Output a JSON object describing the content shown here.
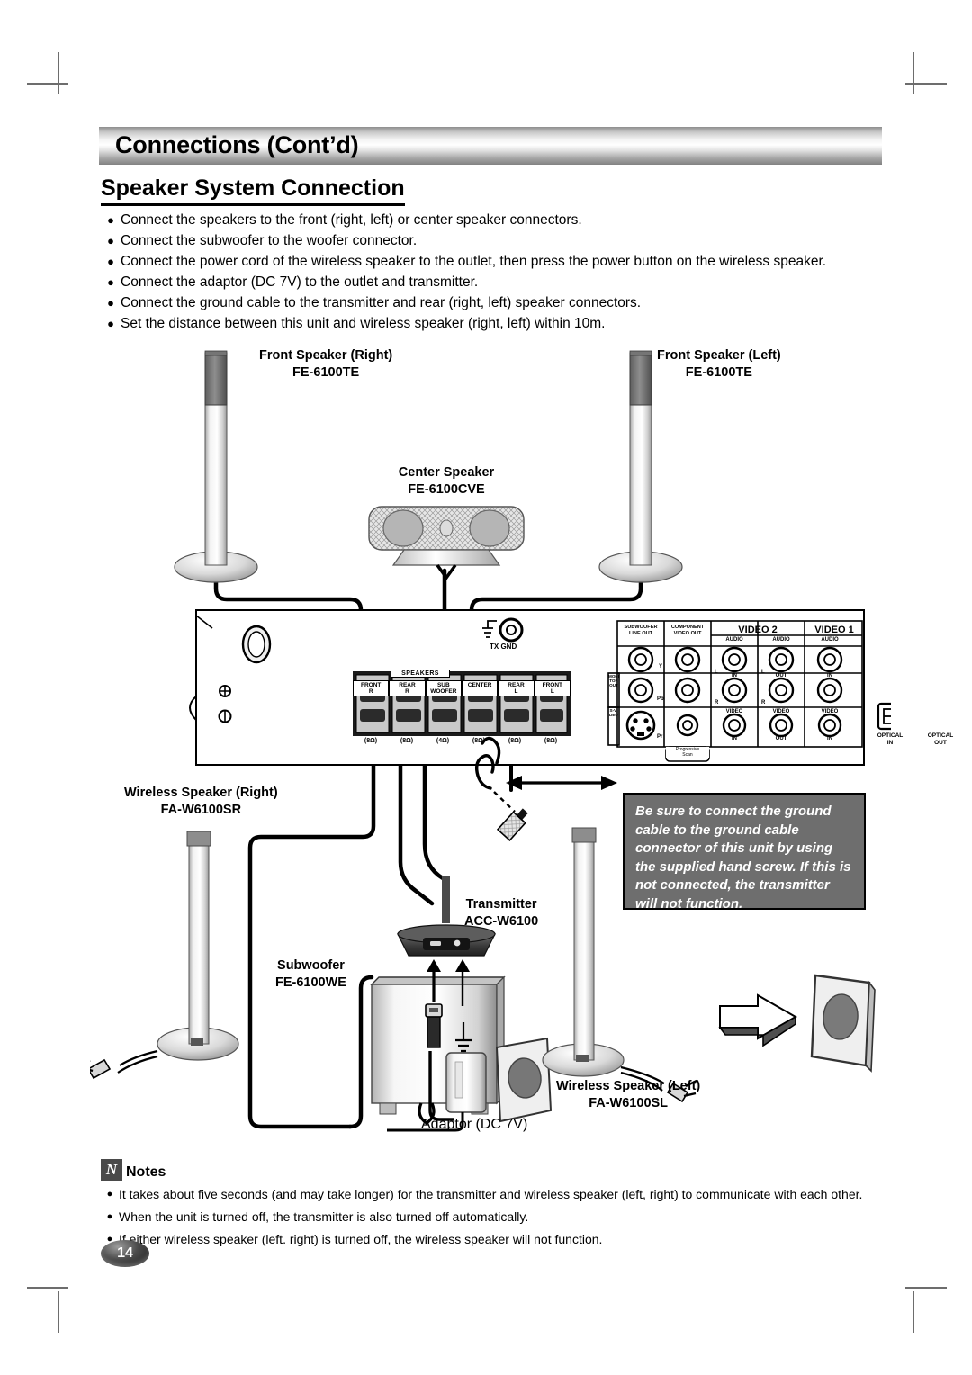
{
  "header": {
    "title": "Connections (Cont’d)",
    "section_title": "Speaker System Connection"
  },
  "instructions": [
    "Connect the speakers to the front (right, left) or center speaker connectors.",
    "Connect the subwoofer to the woofer connector.",
    "Connect the power cord of the wireless speaker to the outlet, then press the power button on the wireless speaker.",
    "Connect the adaptor (DC 7V)  to the outlet and transmitter.",
    "Connect the ground cable to the transmitter and rear (right, left) speaker connectors.",
    "Set the distance between this unit and wireless speaker (right, left) within 10m."
  ],
  "diagram": {
    "front_right": {
      "name": "Front Speaker (Right)",
      "model": "FE-6100TE"
    },
    "front_left": {
      "name": "Front Speaker (Left)",
      "model": "FE-6100TE"
    },
    "center": {
      "name": "Center Speaker",
      "model": "FE-6100CVE"
    },
    "wireless_right": {
      "name": "Wireless Speaker (Right)",
      "model": "FA-W6100SR"
    },
    "wireless_left": {
      "name": "Wireless Speaker (Left)",
      "model": "FA-W6100SL"
    },
    "transmitter": {
      "name": "Transmitter",
      "model": "ACC-W6100"
    },
    "subwoofer": {
      "name": "Subwoofer",
      "model": "FE-6100WE"
    },
    "adaptor_label": "Adaptor (DC 7V)",
    "warning": "Be sure to connect the ground cable to the ground cable connector of this unit by using the supplied hand screw. If this is not connected, the transmitter will not function.",
    "rear_panel": {
      "speakers_header": "SPEAKERS",
      "terminals": [
        {
          "line1": "FRONT",
          "line2": "R",
          "impedance": "(8Ω)"
        },
        {
          "line1": "REAR",
          "line2": "R",
          "impedance": "(8Ω)"
        },
        {
          "line1": "SUB",
          "line2": "WOOFER",
          "impedance": "(4Ω)"
        },
        {
          "line1": "CENTER",
          "line2": "",
          "impedance": "(8Ω)"
        },
        {
          "line1": "REAR",
          "line2": "L",
          "impedance": "(8Ω)"
        },
        {
          "line1": "FRONT",
          "line2": "L",
          "impedance": "(8Ω)"
        }
      ],
      "tx_gnd": "TX GND",
      "subwoofer_line_out": [
        "SUBWOOFER",
        "LINE OUT"
      ],
      "component_video_out": [
        "COMPONENT",
        "VIDEO OUT"
      ],
      "component_labels": [
        "Y",
        "Pb",
        "Pr"
      ],
      "progressive_scan": [
        "Progressive",
        "Scan"
      ],
      "monitor_out": "MONITOR OUT",
      "s_video": "S-VIDEO",
      "video2": "VIDEO 2",
      "video1": "VIDEO 1",
      "audio": "AUDIO",
      "video": "VIDEO",
      "in": "IN",
      "out": "OUT",
      "ch_left": "L",
      "ch_right": "R",
      "optical_in": [
        "OPTICAL",
        "IN"
      ],
      "optical_out": [
        "OPTICAL",
        "OUT"
      ]
    }
  },
  "notes": {
    "icon_letter": "N",
    "label": "Notes",
    "items": [
      "It takes about five seconds (and may take longer) for the transmitter and wireless speaker (left, right) to communicate with each other.",
      "When the unit is turned off, the transmitter is also turned off automatically.",
      "If either wireless speaker (left. right) is turned off, the wireless speaker will not function."
    ]
  },
  "page_number": "14"
}
